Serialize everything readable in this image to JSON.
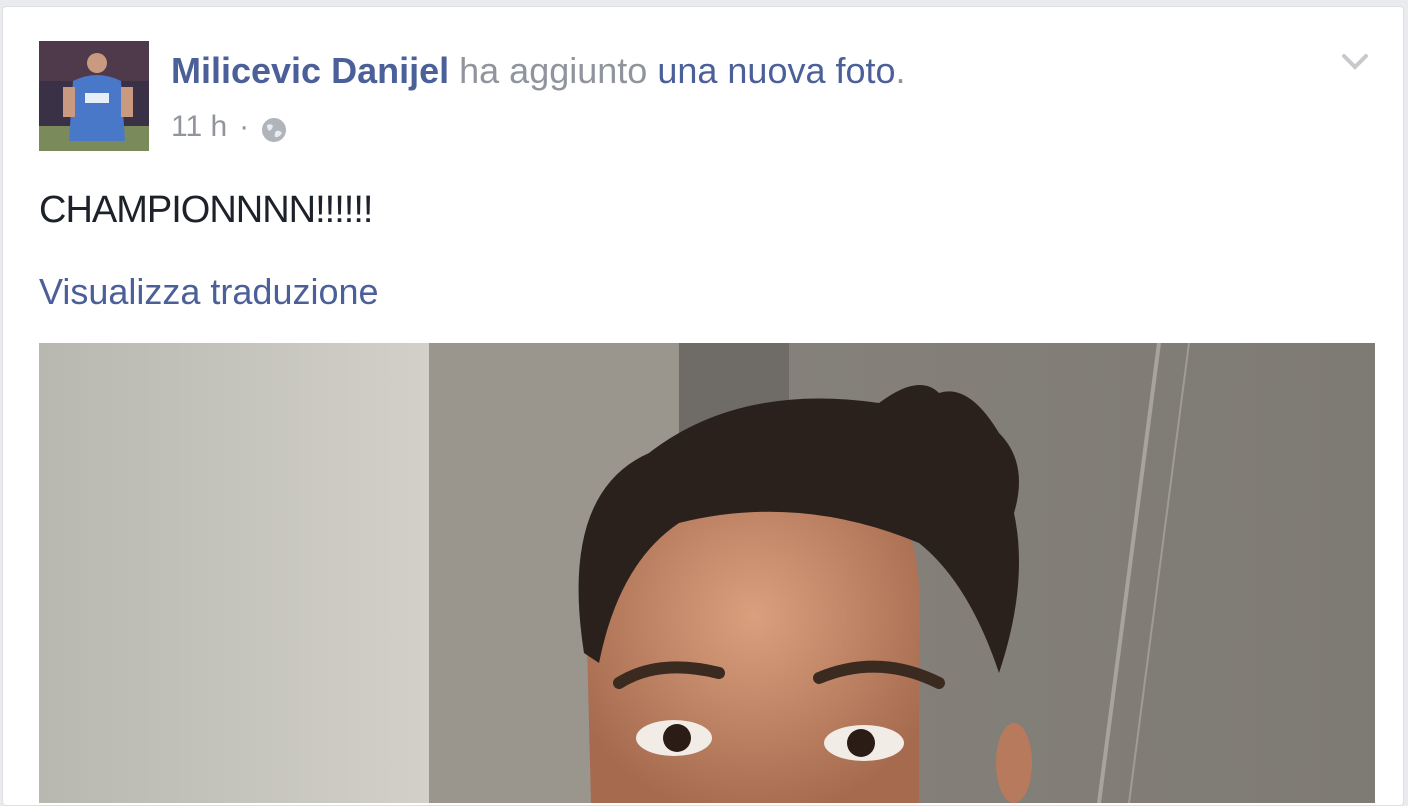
{
  "post": {
    "author_name": "Milicevic Danijel",
    "action_text": "ha aggiunto",
    "object_text": "una nuova foto",
    "action_end": ".",
    "timestamp": "11 h",
    "separator": "·",
    "privacy_icon": "globe-icon",
    "options_icon": "chevron-down-icon",
    "body_text": "CHAMPIONNNN!!!!!!",
    "translate_link": "Visualizza traduzione"
  },
  "colors": {
    "link": "#4b5f99",
    "meta": "#90949c",
    "text": "#1d2129",
    "background": "#e9ebee",
    "card": "#ffffff"
  }
}
